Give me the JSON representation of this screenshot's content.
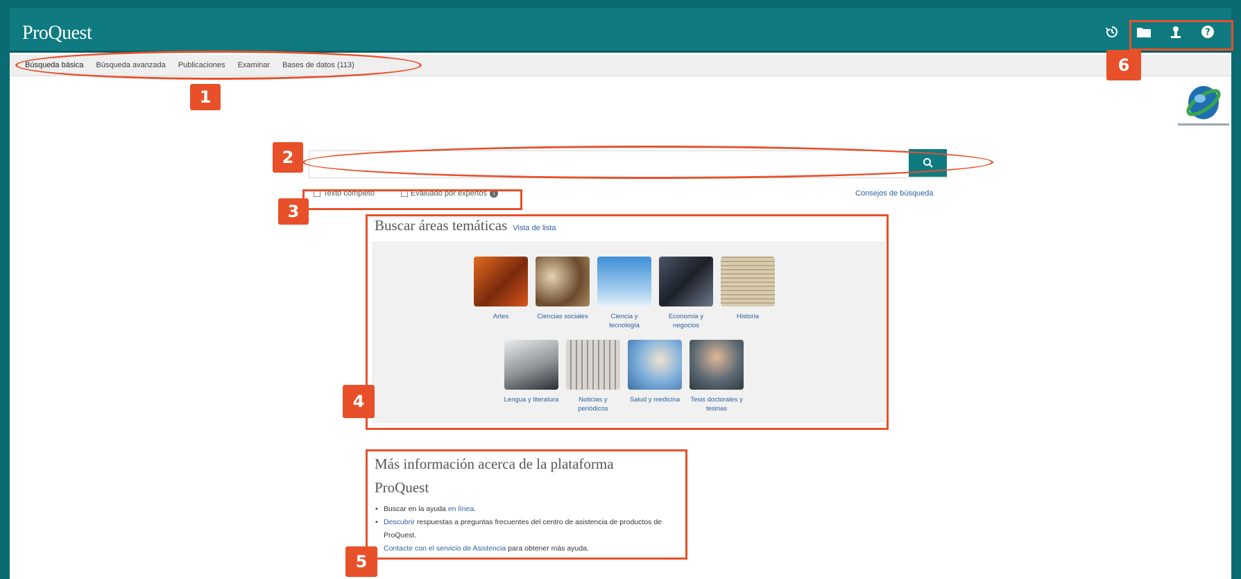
{
  "app": {
    "logo_text": "ProQuest"
  },
  "header_icons": [
    "history-icon",
    "folder-icon",
    "user-icon",
    "help-icon"
  ],
  "nav": {
    "items": [
      "Búsqueda básica",
      "Búsqueda avanzada",
      "Publicaciones",
      "Examinar",
      "Bases de datos (113)"
    ]
  },
  "search": {
    "placeholder": "",
    "button_icon": "search-icon",
    "option_fulltext": "Texto completo",
    "option_peer_reviewed": "Evaluado por expertos",
    "tips_link": "Consejos de búsqueda"
  },
  "areas": {
    "title": "Buscar áreas temáticas",
    "list_view_link": "Vista de lista",
    "row1": [
      {
        "label": "Artes",
        "color": "#c8561a"
      },
      {
        "label": "Ciencias sociales",
        "color": "#9b7a55"
      },
      {
        "label": "Ciencia y tecnología",
        "color": "#6aa3d6"
      },
      {
        "label": "Economía y negocios",
        "color": "#3a3f4a"
      },
      {
        "label": "Historia",
        "color": "#c9bca0"
      }
    ],
    "row2": [
      {
        "label": "Lengua y literatura",
        "color": "#bfc3c5"
      },
      {
        "label": "Noticias y periódicos",
        "color": "#b7b1ad"
      },
      {
        "label": "Salud y medicina",
        "color": "#8fb7da"
      },
      {
        "label": "Tesis doctorales y tesinas",
        "color": "#6f7f8a"
      }
    ]
  },
  "info": {
    "title": "Más información acerca de la plataforma ProQuest",
    "item1_text": "Buscar en la ayuda ",
    "item1_link": "en línea",
    "item2_link": "Descubrir",
    "item2_text": " respuestas a preguntas frecuentes del centro de asistencia de productos de ProQuest.",
    "item3_link": "Contacte con el servicio de Asistencia",
    "item3_text": " para obtener más ayuda."
  },
  "annotations": [
    "1",
    "2",
    "3",
    "4",
    "5",
    "6"
  ],
  "colors": {
    "brand": "#0f7b80",
    "annotation": "#e8502a",
    "link": "#2a5f9e"
  }
}
